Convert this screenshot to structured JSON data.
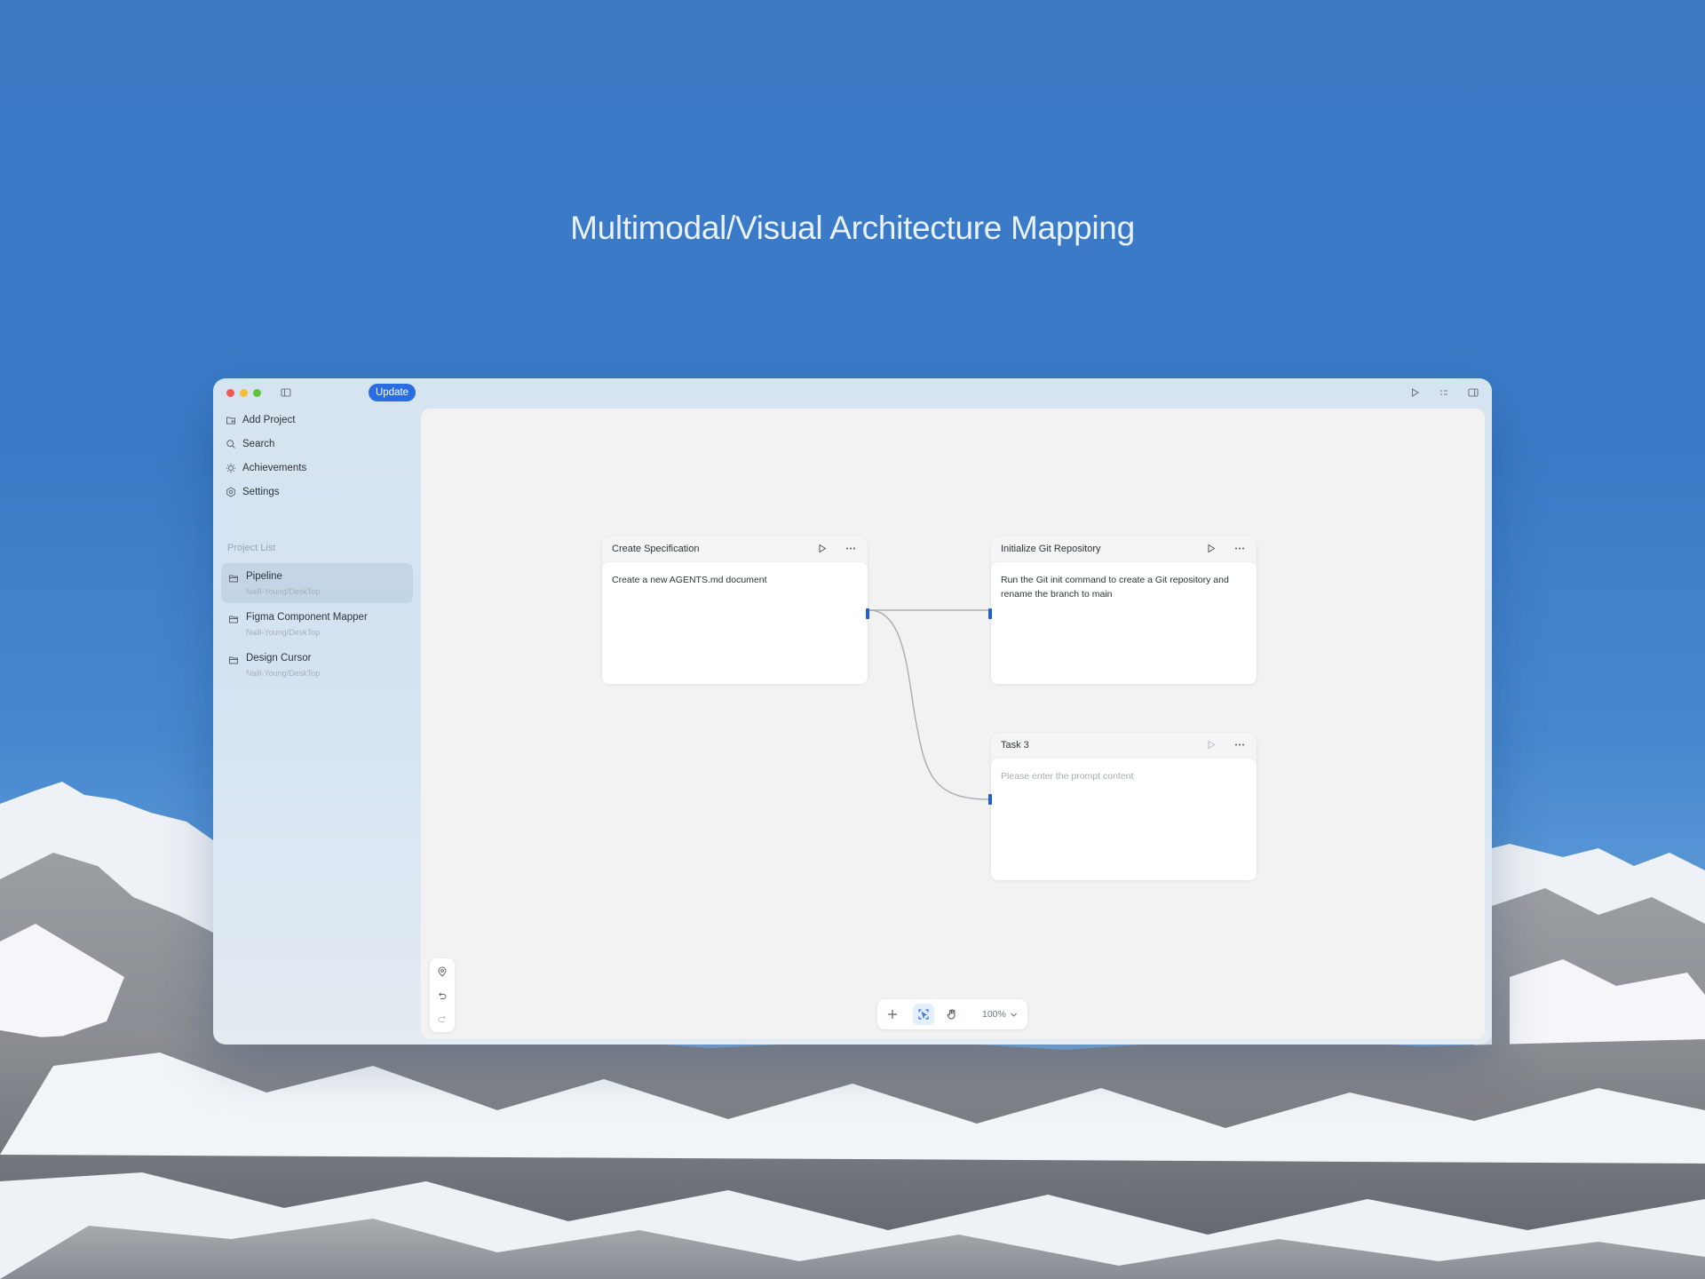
{
  "hero": {
    "title": "Multimodal/Visual Architecture Mapping"
  },
  "titlebar": {
    "update_label": "Update",
    "icons": [
      "sidebar-toggle-icon",
      "run-icon",
      "list-icon",
      "panel-icon"
    ]
  },
  "sidebar": {
    "nav": [
      {
        "label": "Add Project",
        "icon": "folder-plus-icon"
      },
      {
        "label": "Search",
        "icon": "search-icon"
      },
      {
        "label": "Achievements",
        "icon": "sun-icon"
      },
      {
        "label": "Settings",
        "icon": "gear-icon"
      }
    ],
    "section_label": "Project List",
    "projects": [
      {
        "name": "Pipeline",
        "path": "Naill-Young/DeskTop",
        "active": true
      },
      {
        "name": "Figma Component Mapper",
        "path": "Naill-Young/DeskTop",
        "active": false
      },
      {
        "name": "Design Cursor",
        "path": "Naill-Young/DeskTop",
        "active": false
      }
    ]
  },
  "canvas": {
    "nodes": [
      {
        "title": "Create Specification",
        "content": "Create a new AGENTS.md document",
        "placeholder": false
      },
      {
        "title": "Initialize Git Repository",
        "content": "Run the Git init command to create a Git repository and rename the branch to main",
        "placeholder": false
      },
      {
        "title": "Task 3",
        "content": "Please enter the prompt content",
        "placeholder": true
      }
    ],
    "connections": [
      {
        "from": "Create Specification",
        "to": "Initialize Git Repository"
      },
      {
        "from": "Create Specification",
        "to": "Task 3"
      }
    ],
    "toolbar": {
      "zoom": "100%"
    }
  },
  "colors": {
    "accent": "#2a6de3",
    "port": "#1f5fd9",
    "sky": "#3a78c4",
    "canvas_bg": "#f2f2f2"
  }
}
